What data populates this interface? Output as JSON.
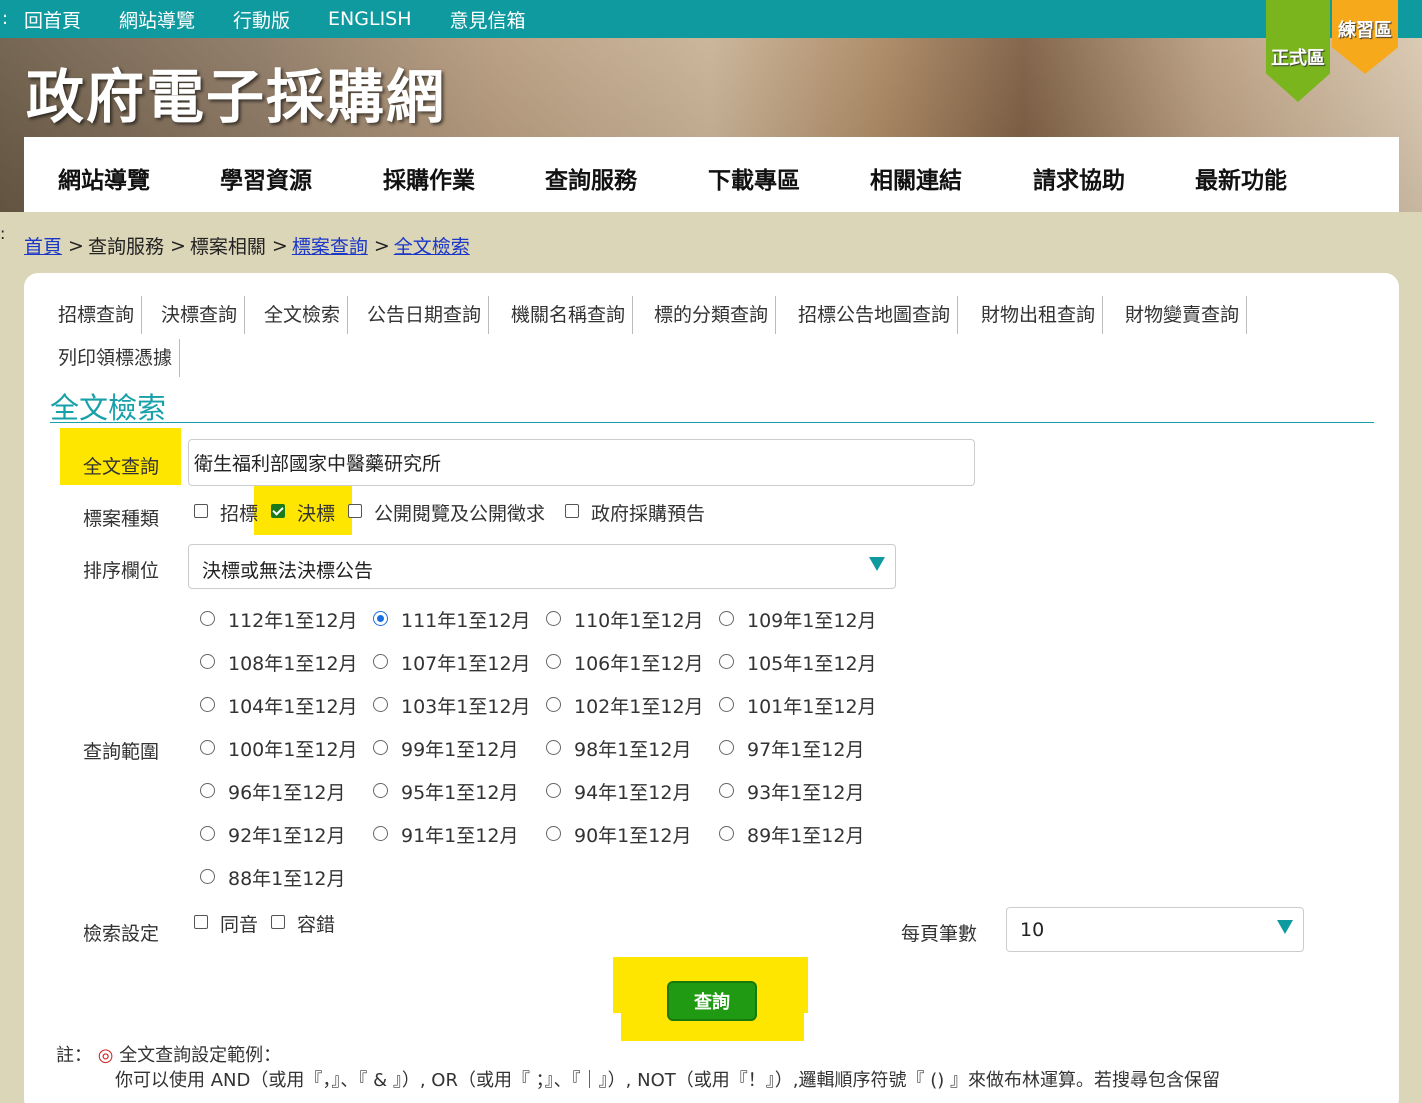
{
  "topbar": {
    "colon": ":",
    "links": [
      "回首頁",
      "網站導覽",
      "行動版",
      "ENGLISH",
      "意見信箱"
    ]
  },
  "banner": {
    "title": "政府電子採購網",
    "flag_formal": "正式區",
    "flag_practice": "練習區"
  },
  "mainnav": [
    "網站導覽",
    "學習資源",
    "採購作業",
    "查詢服務",
    "下載專區",
    "相關連結",
    "請求協助",
    "最新功能"
  ],
  "breadcrumb": {
    "colon": ":",
    "home": "首頁",
    "query_service": "查詢服務",
    "tender_related": "標案相關",
    "tender_query": "標案查詢",
    "fulltext": "全文檢索",
    "sep": ">"
  },
  "tabs": [
    "招標查詢",
    "決標查詢",
    "全文檢索",
    "公告日期查詢",
    "機關名稱查詢",
    "標的分類查詢",
    "招標公告地圖查詢",
    "財物出租查詢",
    "財物變賣查詢",
    "列印領標憑據"
  ],
  "section_title": "全文檢索",
  "form": {
    "fulltext_label": "全文查詢",
    "fulltext_value": "衛生福利部國家中醫藥研究所",
    "type_label": "標案種類",
    "types": [
      {
        "label": "招標",
        "checked": false
      },
      {
        "label": "決標",
        "checked": true
      },
      {
        "label": "公開閱覽及公開徵求",
        "checked": false
      },
      {
        "label": "政府採購預告",
        "checked": false
      }
    ],
    "sort_label": "排序欄位",
    "sort_value": "決標或無法決標公告",
    "range_label": "查詢範圍",
    "ranges": [
      "112年1至12月",
      "111年1至12月",
      "110年1至12月",
      "109年1至12月",
      "108年1至12月",
      "107年1至12月",
      "106年1至12月",
      "105年1至12月",
      "104年1至12月",
      "103年1至12月",
      "102年1至12月",
      "101年1至12月",
      "100年1至12月",
      "99年1至12月",
      "98年1至12月",
      "97年1至12月",
      "96年1至12月",
      "95年1至12月",
      "94年1至12月",
      "93年1至12月",
      "92年1至12月",
      "91年1至12月",
      "90年1至12月",
      "89年1至12月",
      "88年1至12月"
    ],
    "range_selected": "111年1至12月",
    "search_setting_label": "檢索設定",
    "settings": [
      {
        "label": "同音",
        "checked": false
      },
      {
        "label": "容錯",
        "checked": false
      }
    ],
    "per_page_label": "每頁筆數",
    "per_page_value": "10",
    "submit_label": "查詢"
  },
  "note": {
    "prefix": "註：",
    "symbol": "◎",
    "heading": "全文查詢設定範例：",
    "line1": "你可以使用 AND（或用『，』、『 & 』）, OR（或用『 ；』、『｜』）, NOT（或用『！』）,邏輯順序符號『 () 』來做布林運算。若搜尋包含保留"
  },
  "colors": {
    "teal": "#0f9aa0",
    "highlight": "#ffe600",
    "button_green": "#1f9a12",
    "link_blue": "#1a37c8",
    "page_bg": "#dcd6b8"
  }
}
